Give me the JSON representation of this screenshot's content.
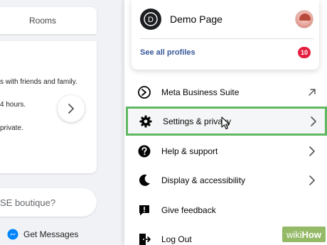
{
  "left": {
    "rooms_title": "Rooms",
    "rooms_lines": [
      "s with friends and family.",
      "4 hours.",
      "private."
    ],
    "search_text": "SE boutique?",
    "get_messages": "Get Messages"
  },
  "menu": {
    "profile": {
      "name": "Demo Page",
      "logo_letter": "D",
      "see_all": "See all profiles",
      "badge_count": "10"
    },
    "items": [
      {
        "label": "Meta Business Suite",
        "icon": "meta-business-icon",
        "arrow": "external-link-arrow"
      },
      {
        "label": "Settings & privacy",
        "icon": "gear-icon",
        "arrow": "chevron-right"
      },
      {
        "label": "Help & support",
        "icon": "question-icon",
        "arrow": "chevron-right"
      },
      {
        "label": "Display & accessibility",
        "icon": "moon-icon",
        "arrow": "chevron-right"
      },
      {
        "label": "Give feedback",
        "icon": "feedback-icon",
        "arrow": null
      },
      {
        "label": "Log Out",
        "icon": "logout-icon",
        "arrow": null
      }
    ],
    "highlighted_item": "Settings & privacy"
  },
  "watermark": {
    "part1": "wiki",
    "part2": "How"
  },
  "colors": {
    "highlight_border": "#5fb85f",
    "link": "#385898",
    "badge": "#e41e3f",
    "messenger": "#0084ff"
  }
}
